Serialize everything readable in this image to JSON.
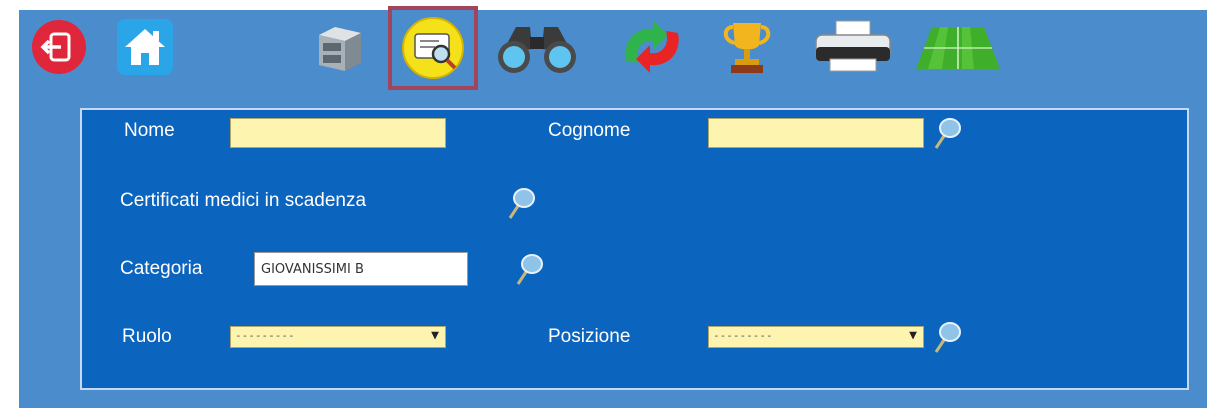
{
  "toolbar": {
    "items": [
      {
        "name": "exit",
        "icon": "exit-icon"
      },
      {
        "name": "home",
        "icon": "home-icon"
      },
      {
        "name": "archive",
        "icon": "filing-cabinet-icon"
      },
      {
        "name": "search",
        "icon": "search-card-icon",
        "selected": true
      },
      {
        "name": "binoculars",
        "icon": "binoculars-icon"
      },
      {
        "name": "refresh",
        "icon": "refresh-arrows-icon"
      },
      {
        "name": "trophy",
        "icon": "trophy-icon"
      },
      {
        "name": "print",
        "icon": "printer-icon"
      },
      {
        "name": "field",
        "icon": "soccer-field-icon"
      }
    ]
  },
  "form": {
    "nome_label": "Nome",
    "nome_value": "",
    "cognome_label": "Cognome",
    "cognome_value": "",
    "certificati_label": "Certificati medici in scadenza",
    "categoria_label": "Categoria",
    "categoria_value": "GIOVANISSIMI B",
    "ruolo_label": "Ruolo",
    "ruolo_value": "---------",
    "posizione_label": "Posizione",
    "posizione_value": "---------"
  },
  "colors": {
    "background": "#4b8dcc",
    "panel": "#0b64be",
    "input_yellow": "#fdf4b0",
    "selected_outline": "#a0455b"
  }
}
